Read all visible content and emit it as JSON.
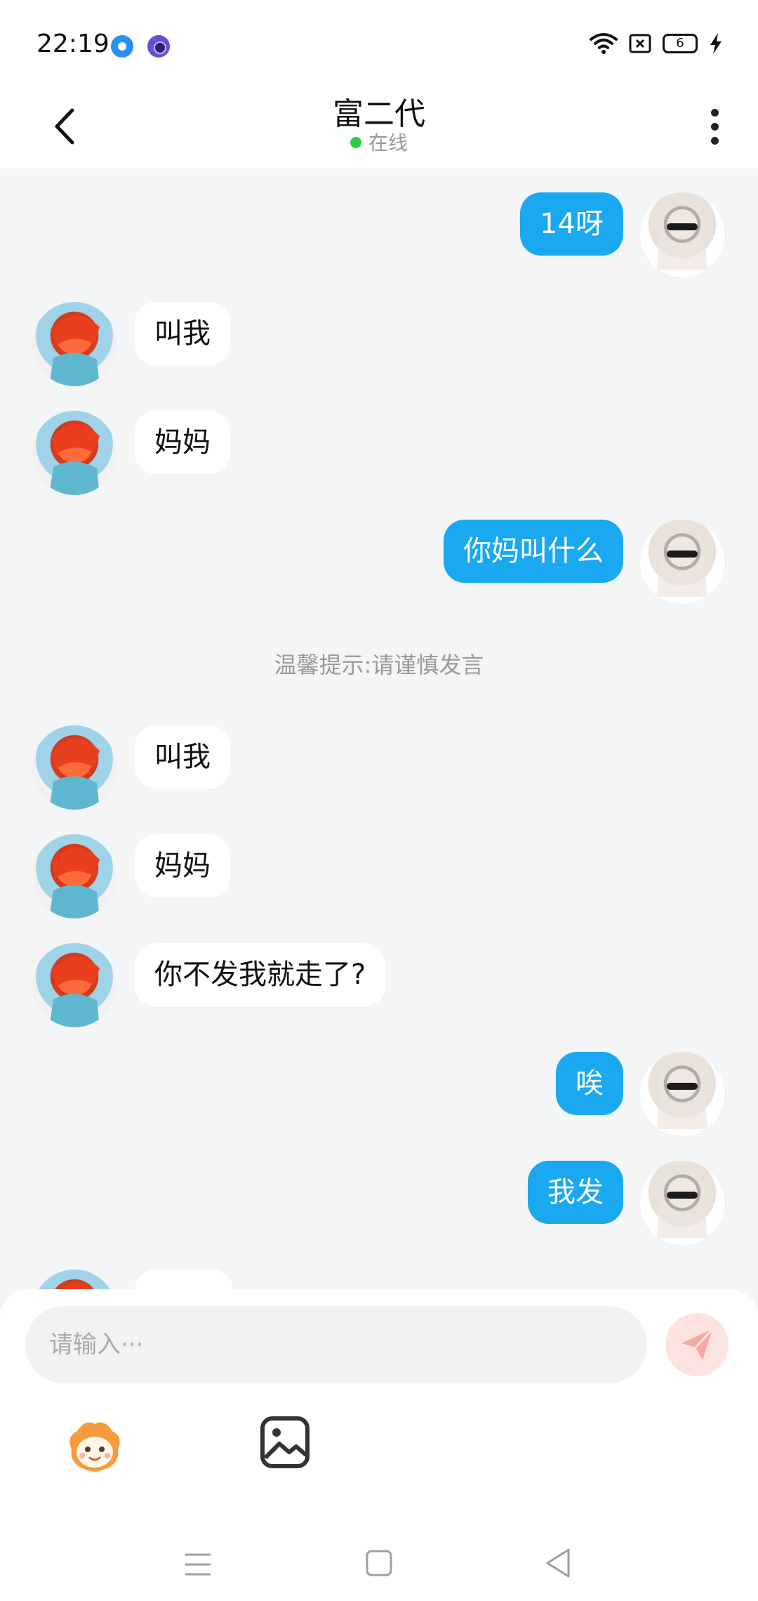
{
  "status_bar": {
    "time": "22:19",
    "battery_level": "6"
  },
  "header": {
    "title": "富二代",
    "status": "在线"
  },
  "messages": [
    {
      "side": "right",
      "text": "14呀"
    },
    {
      "side": "left",
      "text": "叫我"
    },
    {
      "side": "left",
      "text": "妈妈"
    },
    {
      "side": "right",
      "text": "你妈叫什么"
    },
    {
      "side": "system",
      "text": "温馨提示:请谨慎发言"
    },
    {
      "side": "left",
      "text": "叫我"
    },
    {
      "side": "left",
      "text": "妈妈"
    },
    {
      "side": "left",
      "text": "你不发我就走了?"
    },
    {
      "side": "right",
      "text": "唉"
    },
    {
      "side": "right",
      "text": "我发"
    }
  ],
  "input": {
    "placeholder": "请输入···"
  },
  "colors": {
    "accent_blue": "#1aa8f0",
    "online_green": "#2ecc40",
    "send_button_bg": "#fde3e0",
    "send_icon": "#f7a8a0"
  },
  "icons": {
    "back": "chevron-left-icon",
    "more": "more-vertical-icon",
    "send": "paper-plane-icon",
    "emoji": "emoji-face-icon",
    "image": "image-icon",
    "nav_menu": "menu-icon",
    "nav_home": "square-icon",
    "nav_back": "triangle-back-icon"
  }
}
